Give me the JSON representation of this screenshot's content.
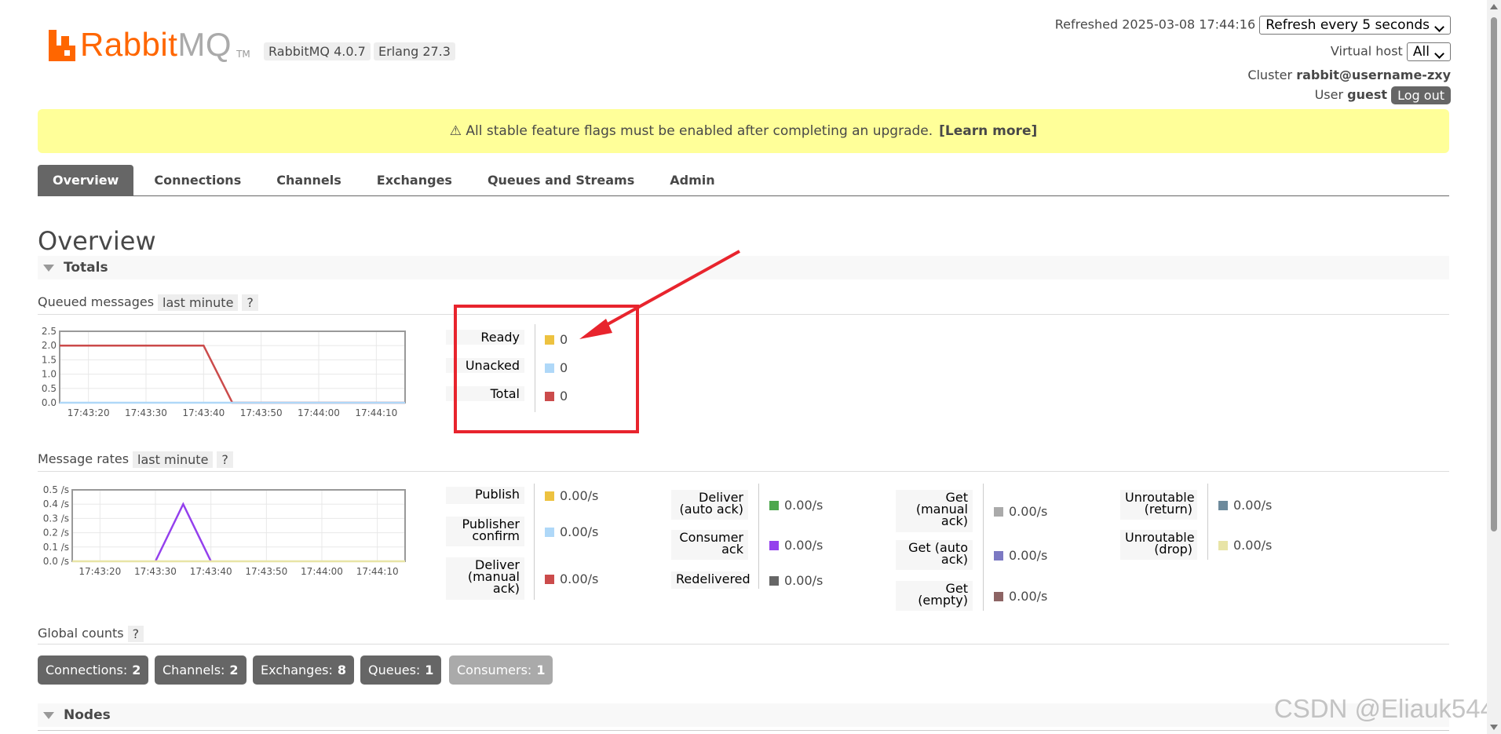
{
  "header": {
    "logo_rabbit": "Rabbit",
    "logo_mq": "MQ",
    "logo_tm": "TM",
    "rabbitmq_version": "RabbitMQ 4.0.7",
    "erlang_version": "Erlang 27.3",
    "refreshed_label": "Refreshed 2025-03-08 17:44:16",
    "refresh_select": "Refresh every 5 seconds",
    "virtual_host_label": "Virtual host",
    "virtual_host_value": "All",
    "cluster_label": "Cluster",
    "cluster_value": "rabbit@username-zxy",
    "user_label": "User",
    "user_value": "guest",
    "logout": "Log out"
  },
  "warning": {
    "text": "⚠ All stable feature flags must be enabled after completing an upgrade.",
    "link": "[Learn more]",
    "bg_color": "#ffff99"
  },
  "tabs": [
    {
      "label": "Overview",
      "active": true
    },
    {
      "label": "Connections"
    },
    {
      "label": "Channels"
    },
    {
      "label": "Exchanges"
    },
    {
      "label": "Queues and Streams"
    },
    {
      "label": "Admin"
    }
  ],
  "page_title": "Overview",
  "totals": {
    "section_label": "Totals",
    "queued": {
      "title": "Queued messages",
      "range": "last minute",
      "help": "?",
      "legend": [
        {
          "label": "Ready",
          "value": "0",
          "color": "#edc240"
        },
        {
          "label": "Unacked",
          "value": "0",
          "color": "#afd8f8"
        },
        {
          "label": "Total",
          "value": "0",
          "color": "#cb4b4b"
        }
      ]
    },
    "rates": {
      "title": "Message rates",
      "range": "last minute",
      "help": "?",
      "col1": [
        {
          "label": "Publish",
          "value": "0.00/s",
          "color": "#edc240"
        },
        {
          "label": "Publisher confirm",
          "value": "0.00/s",
          "color": "#afd8f8"
        },
        {
          "label": "Deliver (manual ack)",
          "value": "0.00/s",
          "color": "#cb4b4b"
        }
      ],
      "col2": [
        {
          "label": "Deliver (auto ack)",
          "value": "0.00/s",
          "color": "#4da74d"
        },
        {
          "label": "Consumer ack",
          "value": "0.00/s",
          "color": "#9440ed"
        },
        {
          "label": "Redelivered",
          "value": "0.00/s",
          "color": "#666666"
        }
      ],
      "col3": [
        {
          "label": "Get (manual ack)",
          "value": "0.00/s",
          "color": "#aaaaaa"
        },
        {
          "label": "Get (auto ack)",
          "value": "0.00/s",
          "color": "#7c79c3"
        },
        {
          "label": "Get (empty)",
          "value": "0.00/s",
          "color": "#8d6464"
        }
      ],
      "col4": [
        {
          "label": "Unroutable (return)",
          "value": "0.00/s",
          "color": "#6d8a9c"
        },
        {
          "label": "Unroutable (drop)",
          "value": "0.00/s",
          "color": "#e8e4a6"
        }
      ]
    },
    "global_counts": {
      "title": "Global counts",
      "help": "?",
      "items": [
        {
          "label": "Connections:",
          "value": "2"
        },
        {
          "label": "Channels:",
          "value": "2"
        },
        {
          "label": "Exchanges:",
          "value": "8"
        },
        {
          "label": "Queues:",
          "value": "1"
        },
        {
          "label": "Consumers:",
          "value": "1"
        }
      ]
    }
  },
  "nodes": {
    "section_label": "Nodes"
  },
  "watermark": "CSDN @Eliauk544",
  "chart_data": [
    {
      "type": "line",
      "title": "Queued messages",
      "x": [
        "17:43:20",
        "17:43:30",
        "17:43:40",
        "17:43:50",
        "17:44:00",
        "17:44:10"
      ],
      "ylim": [
        0,
        2.5
      ],
      "yticks": [
        "0.0",
        "0.5",
        "1.0",
        "1.5",
        "2.0",
        "2.5"
      ],
      "grid": true,
      "series": [
        {
          "name": "Total",
          "color": "#cb4b4b",
          "points": [
            [
              "17:43:15",
              2
            ],
            [
              "17:43:40",
              2
            ],
            [
              "17:43:45",
              0
            ],
            [
              "17:44:15",
              0
            ]
          ]
        },
        {
          "name": "Unacked",
          "color": "#afd8f8",
          "points": [
            [
              "17:43:15",
              0
            ],
            [
              "17:44:15",
              0
            ]
          ]
        }
      ]
    },
    {
      "type": "line",
      "title": "Message rates",
      "x": [
        "17:43:20",
        "17:43:30",
        "17:43:40",
        "17:43:50",
        "17:44:00",
        "17:44:10"
      ],
      "ylim": [
        0,
        0.5
      ],
      "yticks": [
        "0.0 /s",
        "0.1 /s",
        "0.2 /s",
        "0.3 /s",
        "0.4 /s",
        "0.5 /s"
      ],
      "grid": true,
      "series": [
        {
          "name": "Consumer ack",
          "color": "#9440ed",
          "points": [
            [
              "17:43:30",
              0
            ],
            [
              "17:43:35",
              0.4
            ],
            [
              "17:43:40",
              0
            ]
          ]
        },
        {
          "name": "Unroutable (drop)",
          "color": "#e8e4a6",
          "points": [
            [
              "17:43:15",
              0
            ],
            [
              "17:44:15",
              0
            ]
          ]
        }
      ]
    }
  ],
  "annotation": {
    "color": "#e8242d"
  }
}
